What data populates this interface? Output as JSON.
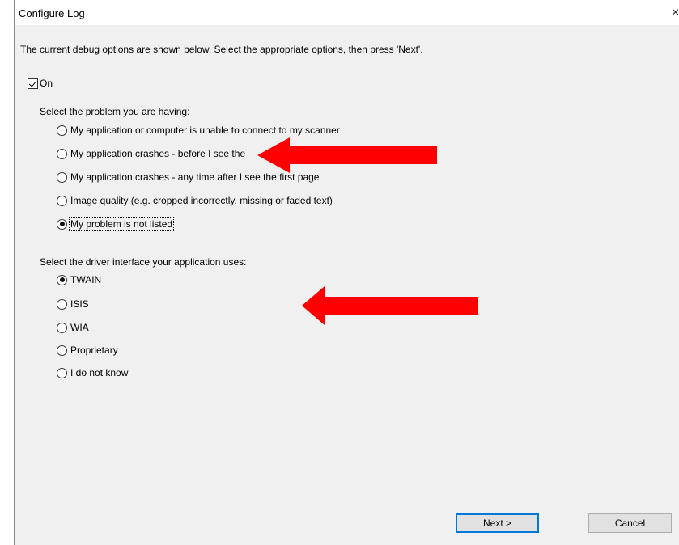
{
  "window": {
    "title": "Configure Log",
    "close_glyph": "×"
  },
  "intro_text": "The current debug options are shown below. Select the appropriate options, then press 'Next'.",
  "enable": {
    "label": "On",
    "checked": true
  },
  "problem": {
    "label": "Select the problem you are having:",
    "options": [
      {
        "label": "My application or computer is unable to connect to my scanner",
        "selected": false
      },
      {
        "label": "My application crashes - before I see the",
        "selected": false
      },
      {
        "label": "My application crashes - any time after I see the first page",
        "selected": false
      },
      {
        "label": "Image quality (e.g. cropped incorrectly, missing or faded text)",
        "selected": false
      },
      {
        "label": "My problem is not listed",
        "selected": true
      }
    ]
  },
  "driver": {
    "label": "Select the driver interface your application uses:",
    "options": [
      {
        "label": "TWAIN",
        "selected": true
      },
      {
        "label": "ISIS",
        "selected": false
      },
      {
        "label": "WIA",
        "selected": false
      },
      {
        "label": "Proprietary",
        "selected": false
      },
      {
        "label": "I do not know",
        "selected": false
      }
    ]
  },
  "buttons": {
    "next": "Next >",
    "cancel": "Cancel"
  },
  "annotations": {
    "arrow_color": "#ff0000",
    "arrow_count": 2
  }
}
